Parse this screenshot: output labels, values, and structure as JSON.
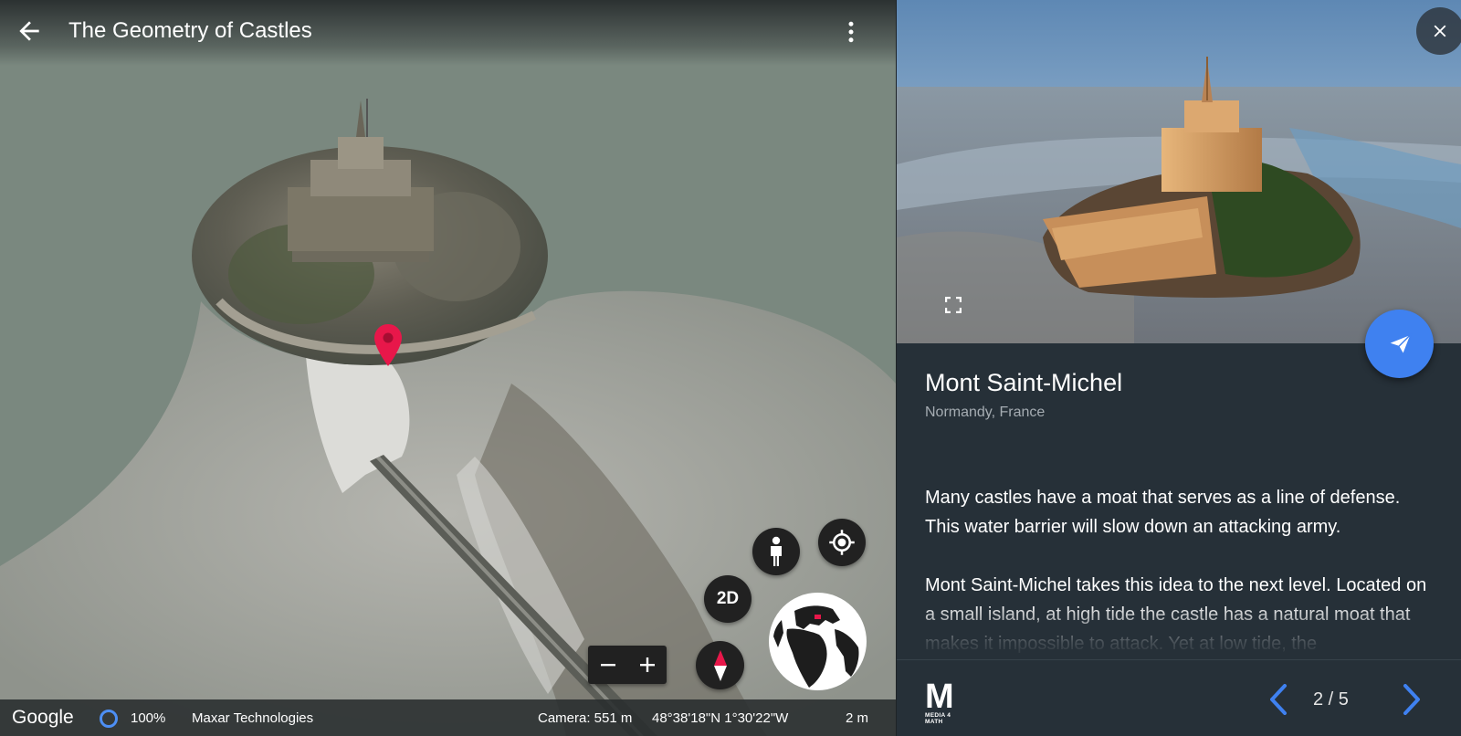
{
  "header": {
    "title": "The Geometry of Castles"
  },
  "map_controls": {
    "mode_2d_label": "2D",
    "zoom_out_symbol": "−",
    "zoom_in_symbol": "+"
  },
  "status_bar": {
    "brand": "Google",
    "load_percent": "100%",
    "imagery_credit": "Maxar Technologies",
    "camera": "Camera: 551 m",
    "coordinates": "48°38'18\"N 1°30'22\"W",
    "scale": "2 m"
  },
  "place": {
    "title": "Mont Saint-Michel",
    "subtitle": "Normandy, France",
    "paragraphs": [
      "Many castles have a moat that serves as a line of defense. This water barrier will slow down an attacking army.",
      "Mont Saint-Michel takes this idea to the next level. Located on a small island, at high tide the castle has a natural moat that makes it impossible to attack. Yet at low tide, the"
    ]
  },
  "footer": {
    "logo_mark": "M",
    "logo_text": "MEDIA 4 MATH",
    "pager": "2 / 5"
  },
  "colors": {
    "accent_blue": "#3f81f0",
    "marker_red": "#e8174a",
    "panel_bg": "#263038"
  },
  "icons": [
    "arrow-back-icon",
    "more-vert-icon",
    "pegman-icon",
    "my-location-icon",
    "compass-icon",
    "globe-icon",
    "close-icon",
    "fullscreen-icon",
    "send-icon",
    "chevron-left-icon",
    "chevron-right-icon"
  ]
}
